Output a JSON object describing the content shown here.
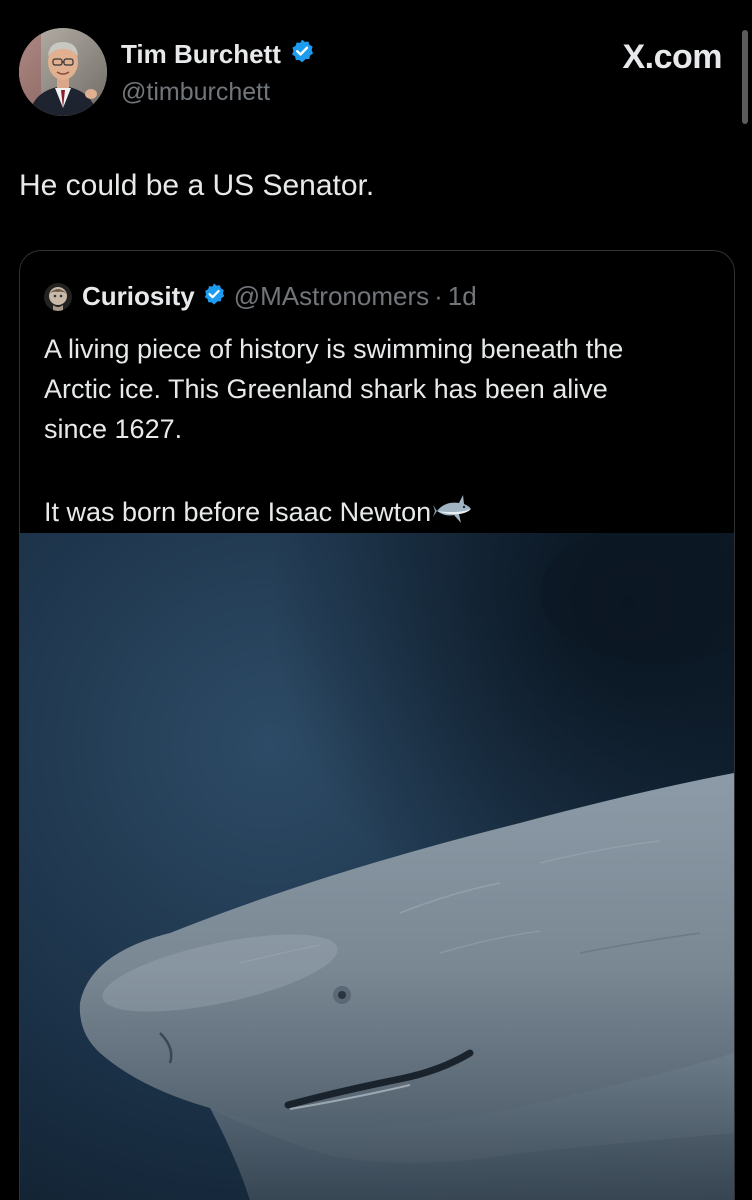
{
  "author": {
    "name": "Tim Burchett",
    "handle": "@timburchett",
    "verified": true
  },
  "site_label": "X.com",
  "tweet": {
    "text": "He could be a US Senator."
  },
  "quoted_tweet": {
    "name": "Curiosity",
    "handle": "@MAstronomers",
    "separator": "·",
    "time": "1d",
    "verified": true,
    "body_lines": [
      "A living piece of history is swimming beneath the",
      "Arctic ice. This Greenland shark has been alive",
      "since 1627."
    ],
    "body_second_paragraph": "It was born before Isaac Newton",
    "trailing_emoji": "shark-icon"
  },
  "colors": {
    "background": "#000000",
    "text_primary": "#e7e9ea",
    "text_secondary": "#71767b",
    "verified_blue": "#1d9bf0",
    "card_border": "#2f3336"
  }
}
